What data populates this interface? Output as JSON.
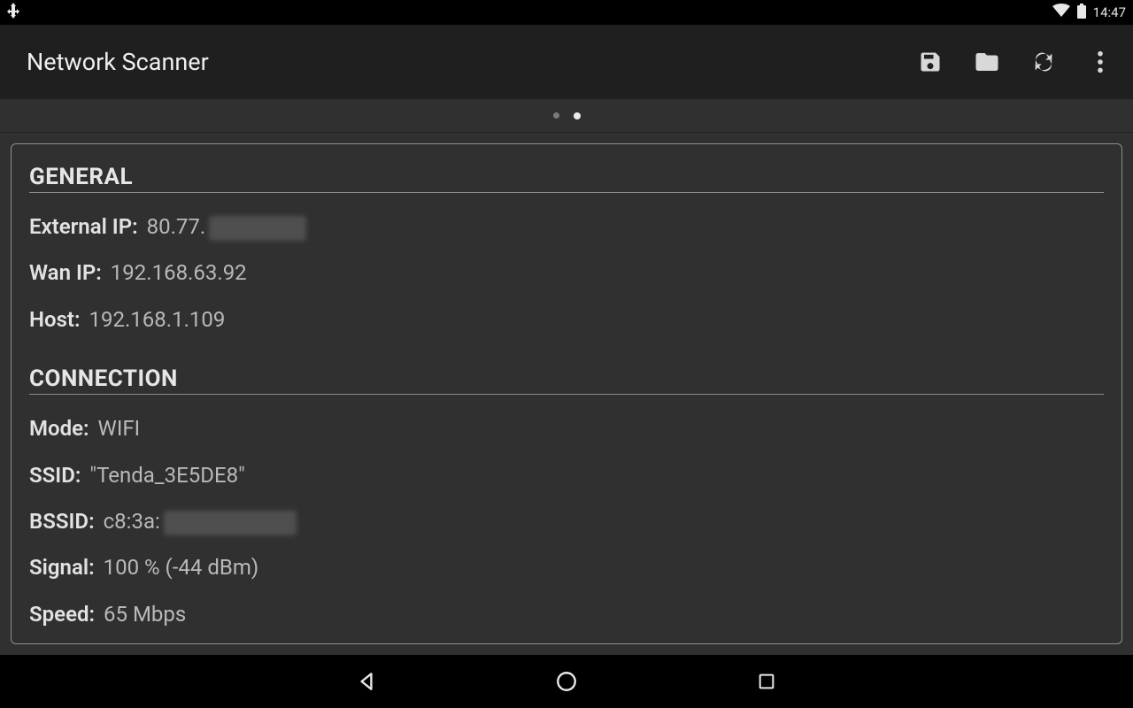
{
  "status": {
    "time": "14:47"
  },
  "appbar": {
    "title": "Network Scanner"
  },
  "sections": {
    "general": {
      "heading": "GENERAL",
      "external_ip_label": "External IP:",
      "external_ip_value": "80.77.",
      "wan_ip_label": "Wan IP:",
      "wan_ip_value": "192.168.63.92",
      "host_label": "Host:",
      "host_value": "192.168.1.109"
    },
    "connection": {
      "heading": "CONNECTION",
      "mode_label": "Mode:",
      "mode_value": "WIFI",
      "ssid_label": "SSID:",
      "ssid_value": "\"Tenda_3E5DE8\"",
      "bssid_label": "BSSID:",
      "bssid_value": "c8:3a:",
      "signal_label": "Signal:",
      "signal_value": "100 % (-44 dBm)",
      "speed_label": "Speed:",
      "speed_value": "65 Mbps"
    }
  },
  "pager": {
    "current_index": 1,
    "total": 2
  }
}
